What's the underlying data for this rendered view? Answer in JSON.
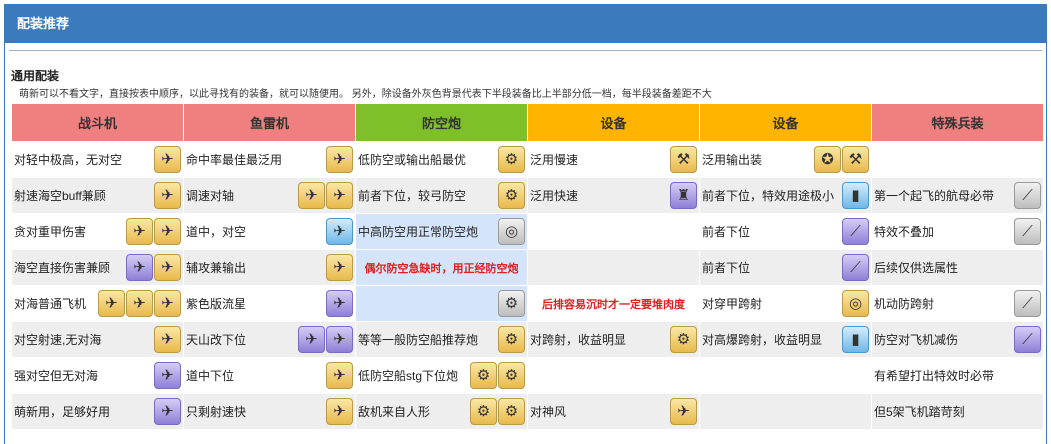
{
  "panel": {
    "title": "配装推荐",
    "section_title": "通用配装",
    "section_desc": "萌新可以不看文字，直接按表中顺序，以此寻找有的装备，就可以随便用。 另外，除设备外灰色背景代表下半段装备比上半部分低一档，每半段装备差距不大"
  },
  "colors": {
    "header_bg": "#3a7abd",
    "col_fighter": "#f08080",
    "col_torpedo": "#f08080",
    "col_aa": "#7fbf2a",
    "col_aux1": "#ffb400",
    "col_aux2": "#ffb400",
    "col_special": "#f08080",
    "red_text": "#e02020",
    "aa_highlight": "#d4e5fb",
    "gray_row": "#eeeeee"
  },
  "table": {
    "headers": [
      "战斗机",
      "鱼雷机",
      "防空炮",
      "设备",
      "设备",
      "特殊兵装"
    ],
    "rows": [
      {
        "bg": "white",
        "cells": [
          {
            "text": "对轻中极高，无对空",
            "icons": [
              {
                "name": "fighter-plane-icon",
                "tone": "gold",
                "glyph": "✈"
              }
            ]
          },
          {
            "text": "命中率最佳最泛用",
            "icons": [
              {
                "name": "torpedo-bomber-icon",
                "tone": "gold",
                "glyph": "✈"
              }
            ]
          },
          {
            "text": "低防空或输出船最优",
            "icons": [
              {
                "name": "aa-gun-icon",
                "tone": "gold",
                "glyph": "⚙"
              }
            ]
          },
          {
            "text": "泛用慢速",
            "icons": [
              {
                "name": "catapult-icon",
                "tone": "gold",
                "glyph": "⚒"
              }
            ]
          },
          {
            "text": "泛用输出装",
            "icons": [
              {
                "name": "medal-icon",
                "tone": "gold",
                "glyph": "✪"
              },
              {
                "name": "hydraulic-catapult-icon",
                "tone": "gold",
                "glyph": "⚒"
              }
            ]
          },
          {
            "text": "",
            "icons": []
          }
        ]
      },
      {
        "bg": "gray",
        "cells": [
          {
            "text": "射速海空buff兼顾",
            "icons": [
              {
                "name": "fighter-plane-icon",
                "tone": "gold",
                "glyph": "✈"
              }
            ]
          },
          {
            "text": "调速对轴",
            "icons": [
              {
                "name": "torpedo-bomber-icon",
                "tone": "gold",
                "glyph": "✈"
              },
              {
                "name": "torpedo-bomber-icon",
                "tone": "gold",
                "glyph": "✈"
              }
            ]
          },
          {
            "text": "前者下位，较弓防空",
            "icons": [
              {
                "name": "aa-gun-icon",
                "tone": "gold",
                "glyph": "⚙"
              }
            ]
          },
          {
            "text": "泛用快速",
            "icons": [
              {
                "name": "lantern-icon",
                "tone": "purple",
                "glyph": "♜"
              }
            ]
          },
          {
            "text": "前者下位，特效用途极小",
            "icons": [
              {
                "name": "fuel-tank-icon",
                "tone": "blue",
                "glyph": "▮"
              }
            ]
          },
          {
            "text": "第一个起飞的航母必带",
            "icons": [
              {
                "name": "wand-icon",
                "tone": "silver",
                "glyph": "⟋"
              }
            ]
          }
        ]
      },
      {
        "bg": "white",
        "cells": [
          {
            "text": "贪对重甲伤害",
            "icons": [
              {
                "name": "fighter-plane-icon",
                "tone": "gold",
                "glyph": "✈"
              },
              {
                "name": "fighter-plane-icon",
                "tone": "gold",
                "glyph": "✈"
              }
            ]
          },
          {
            "text": "道中，对空",
            "icons": [
              {
                "name": "torpedo-bomber-icon",
                "tone": "blue",
                "glyph": "✈"
              }
            ]
          },
          {
            "text": "中高防空用正常防空炮",
            "icons": [
              {
                "name": "aa-gun-icon",
                "tone": "silver",
                "glyph": "◎"
              }
            ]
          },
          {
            "text": "",
            "icons": []
          },
          {
            "text": "前者下位",
            "icons": [
              {
                "name": "catapult-icon",
                "tone": "purple",
                "glyph": "⟋"
              }
            ]
          },
          {
            "text": "特效不叠加",
            "icons": [
              {
                "name": "hook-icon",
                "tone": "silver",
                "glyph": "⟋"
              }
            ]
          }
        ]
      },
      {
        "bg": "gray",
        "cells": [
          {
            "text": "海空直接伤害兼顾",
            "icons": [
              {
                "name": "fighter-plane-icon",
                "tone": "purple",
                "glyph": "✈"
              },
              {
                "name": "fighter-plane-icon",
                "tone": "gold",
                "glyph": "✈"
              }
            ]
          },
          {
            "text": "辅攻兼输出",
            "icons": [
              {
                "name": "torpedo-bomber-icon",
                "tone": "gold",
                "glyph": "✈"
              }
            ]
          },
          {
            "text": "偶尔防空急缺时，用正经防空炮",
            "red": true,
            "icons": []
          },
          {
            "text": "",
            "icons": []
          },
          {
            "text": "前者下位",
            "icons": [
              {
                "name": "catapult-icon",
                "tone": "purple",
                "glyph": "⟋"
              }
            ]
          },
          {
            "text": "后续仅供选属性",
            "icons": []
          }
        ]
      },
      {
        "bg": "white",
        "cells": [
          {
            "text": "对海普通飞机",
            "icons": [
              {
                "name": "fighter-plane-icon",
                "tone": "gold",
                "glyph": "✈"
              },
              {
                "name": "fighter-plane-icon",
                "tone": "gold",
                "glyph": "✈"
              },
              {
                "name": "fighter-plane-icon",
                "tone": "gold",
                "glyph": "✈"
              }
            ]
          },
          {
            "text": "紫色版流星",
            "icons": [
              {
                "name": "torpedo-bomber-icon",
                "tone": "purple",
                "glyph": "✈"
              }
            ]
          },
          {
            "text": "",
            "icons": [
              {
                "name": "aa-gun-icon",
                "tone": "silver",
                "glyph": "⚙"
              }
            ]
          },
          {
            "text": "后排容易沉时才一定要堆肉度",
            "red": true,
            "center": true,
            "icons": []
          },
          {
            "text": "对穿甲跨射",
            "icons": [
              {
                "name": "radar-icon",
                "tone": "gold",
                "glyph": "◎"
              }
            ]
          },
          {
            "text": "机动防跨射",
            "icons": [
              {
                "name": "wand-icon",
                "tone": "silver",
                "glyph": "⟋"
              }
            ]
          }
        ]
      },
      {
        "bg": "gray",
        "cells": [
          {
            "text": "对空射速,无对海",
            "icons": [
              {
                "name": "fighter-plane-icon",
                "tone": "gold",
                "glyph": "✈"
              }
            ]
          },
          {
            "text": "天山改下位",
            "icons": [
              {
                "name": "torpedo-bomber-icon",
                "tone": "purple",
                "glyph": "✈"
              },
              {
                "name": "torpedo-bomber-icon",
                "tone": "purple",
                "glyph": "✈"
              }
            ]
          },
          {
            "text": "等等一般防空船推荐炮",
            "icons": [
              {
                "name": "aa-gun-icon",
                "tone": "gold",
                "glyph": "⚙"
              }
            ]
          },
          {
            "text": "对跨射，收益明显",
            "icons": [
              {
                "name": "engine-icon",
                "tone": "gold",
                "glyph": "⚙"
              }
            ]
          },
          {
            "text": "对高爆跨射，收益明显",
            "icons": [
              {
                "name": "fire-extinguisher-icon",
                "tone": "blue",
                "glyph": "▮"
              }
            ]
          },
          {
            "text": "防空对飞机减伤",
            "icons": [
              {
                "name": "bow-icon",
                "tone": "purple",
                "glyph": "⟋"
              }
            ]
          }
        ]
      },
      {
        "bg": "white",
        "cells": [
          {
            "text": "强对空但无对海",
            "icons": [
              {
                "name": "fighter-plane-icon",
                "tone": "purple",
                "glyph": "✈"
              }
            ]
          },
          {
            "text": "道中下位",
            "icons": [
              {
                "name": "torpedo-bomber-icon",
                "tone": "gold",
                "glyph": "✈"
              }
            ]
          },
          {
            "text": "低防空船stg下位炮",
            "icons": [
              {
                "name": "aa-gun-icon",
                "tone": "gold",
                "glyph": "⚙"
              },
              {
                "name": "aa-gun-icon",
                "tone": "gold",
                "glyph": "⚙"
              }
            ]
          },
          {
            "text": "",
            "icons": []
          },
          {
            "text": "",
            "icons": []
          },
          {
            "text": "有希望打出特效时必带",
            "icons": []
          }
        ]
      },
      {
        "bg": "gray",
        "cells": [
          {
            "text": "萌新用，足够好用",
            "icons": [
              {
                "name": "fighter-plane-icon",
                "tone": "purple",
                "glyph": "✈"
              }
            ]
          },
          {
            "text": "只剩射速快",
            "icons": [
              {
                "name": "torpedo-bomber-icon",
                "tone": "gold",
                "glyph": "✈"
              }
            ]
          },
          {
            "text": "敌机来自人形",
            "icons": [
              {
                "name": "aa-gun-icon",
                "tone": "gold",
                "glyph": "⚙"
              },
              {
                "name": "aa-gun-icon",
                "tone": "gold",
                "glyph": "⚙"
              }
            ]
          },
          {
            "text": "对神风",
            "icons": [
              {
                "name": "plane-icon",
                "tone": "gold",
                "glyph": "✈"
              }
            ]
          },
          {
            "text": "",
            "icons": []
          },
          {
            "text": "但5架飞机踏苛刻",
            "icons": []
          }
        ]
      }
    ]
  }
}
